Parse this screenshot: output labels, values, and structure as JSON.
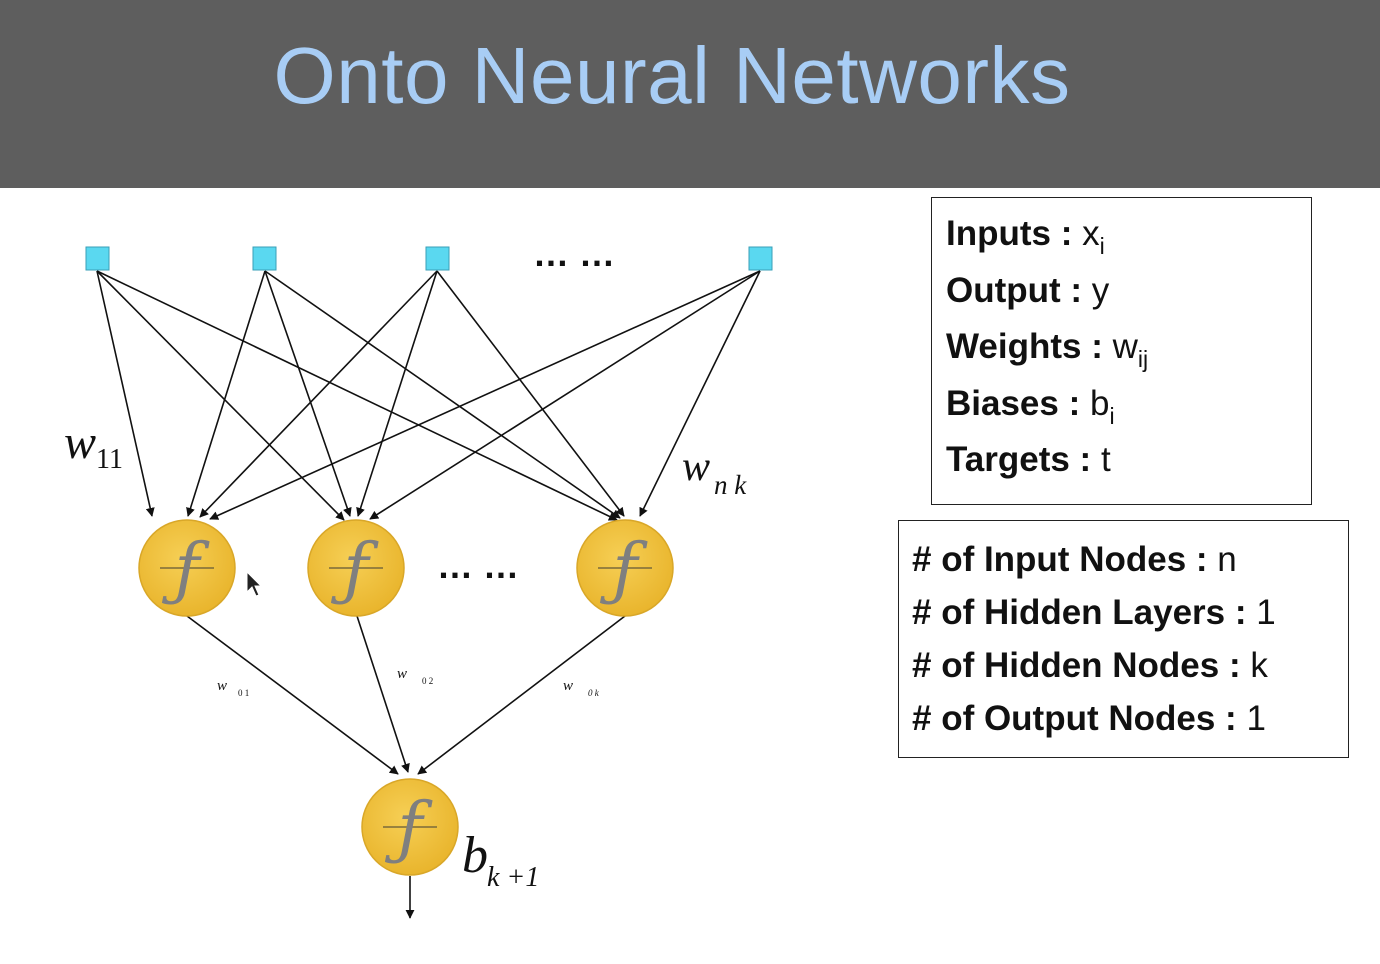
{
  "title": "Onto Neural Networks",
  "diagram": {
    "label_w11_base": "w",
    "label_w11_sub": "11",
    "label_wnk_base": "w",
    "label_wnk_sub": "n k",
    "label_w01_base": "w",
    "label_w01_sub": "0 1",
    "label_w02_base": "w",
    "label_w02_sub": "0 2",
    "label_w0k_base": "w",
    "label_w0k_sub": "0 k",
    "label_b_base": "b",
    "label_b_sub": "k +1",
    "node_symbol": "ƒ",
    "ellipsis_inputs": "… …",
    "ellipsis_hidden": "… …",
    "input_color": "#5ad8f0",
    "node_color": "#f2c23f",
    "input_node_count_drawn": 4,
    "hidden_node_count_drawn": 3
  },
  "legend": {
    "variables": [
      {
        "label": "Inputs :",
        "value": "x",
        "sub": "i"
      },
      {
        "label": "Output :",
        "value": "y",
        "sub": ""
      },
      {
        "label": "Weights :",
        "value": "w",
        "sub": "ij"
      },
      {
        "label": "Biases :",
        "value": "b",
        "sub": "i"
      },
      {
        "label": "Targets :",
        "value": "t",
        "sub": ""
      }
    ],
    "structure": [
      {
        "label": "# of Input Nodes :",
        "value": "n"
      },
      {
        "label": "# of Hidden Layers :",
        "value": "1"
      },
      {
        "label": "# of Hidden Nodes :",
        "value": "k"
      },
      {
        "label": "# of Output Nodes :",
        "value": "1"
      }
    ]
  }
}
